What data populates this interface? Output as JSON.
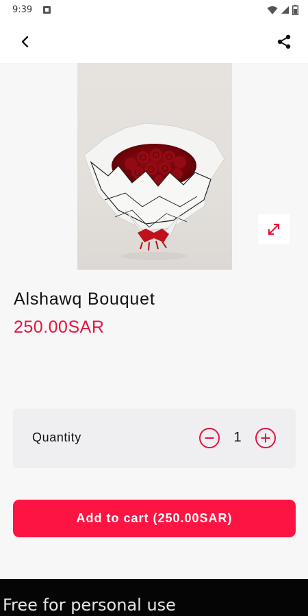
{
  "status_bar": {
    "time": "9:39",
    "icons": [
      "notification-icon",
      "wifi-icon",
      "signal-icon",
      "battery-icon"
    ]
  },
  "app_bar": {
    "back_icon": "back-arrow-icon",
    "share_icon": "share-icon"
  },
  "product": {
    "title": "Alshawq Bouquet",
    "price": "250.00SAR",
    "expand_icon": "expand-icon"
  },
  "quantity": {
    "label": "Quantity",
    "value": "1",
    "minus_icon": "minus-circle-icon",
    "plus_icon": "plus-circle-icon"
  },
  "actions": {
    "add_to_cart_label": "Add to cart (250.00SAR)"
  },
  "watermark": {
    "text": "Free for personal use"
  },
  "colors": {
    "accent": "#fe1443",
    "price": "#e8133b",
    "background": "#f7f7f8",
    "card": "#efeff2"
  }
}
